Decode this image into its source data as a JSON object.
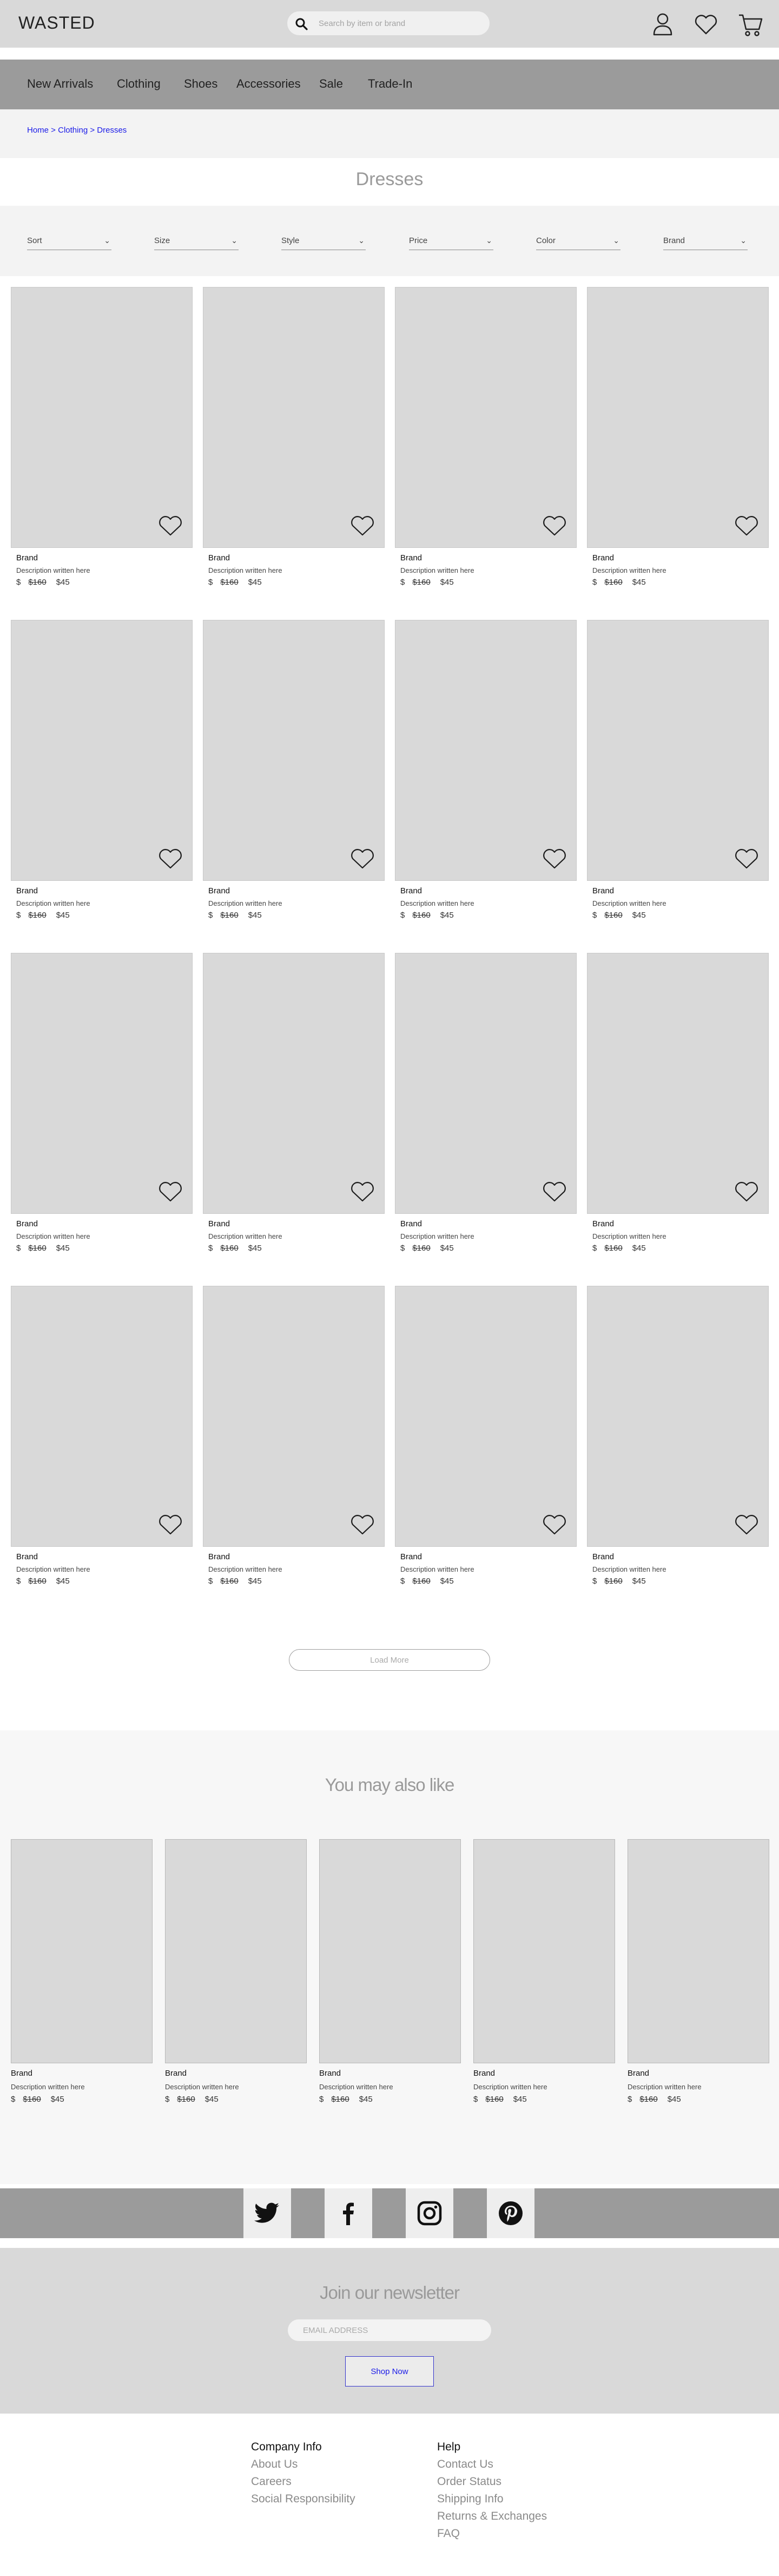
{
  "header": {
    "logo": "WASTED",
    "search_placeholder": "Search by item or brand",
    "icons": [
      "search-icon",
      "user-icon",
      "heart-icon",
      "cart-icon"
    ]
  },
  "nav": {
    "items": [
      "New Arrivals",
      "Clothing",
      "Shoes",
      "Accessories",
      "Sale",
      "Trade-In"
    ]
  },
  "breadcrumb": {
    "home": "Home",
    "sep1": " > ",
    "clothing": "Clothing",
    "sep2": " > ",
    "current": "Dresses"
  },
  "page_title": "Dresses",
  "filters": [
    "Sort",
    "Size",
    "Style",
    "Price",
    "Color",
    "Brand"
  ],
  "filter_chevron": "⌄",
  "product": {
    "brand": "Brand",
    "description": "Description written here",
    "currency": "$",
    "old_price": "$160",
    "new_price": "$45"
  },
  "load_more": "Load More",
  "recommendations": {
    "title": "You may also like"
  },
  "social": {
    "icons": [
      "twitter-icon",
      "facebook-icon",
      "instagram-icon",
      "pinterest-icon"
    ]
  },
  "newsletter": {
    "title": "Join our newsletter",
    "placeholder": "EMAIL ADDRESS",
    "button": "Shop Now"
  },
  "footer": {
    "company": {
      "heading": "Company Info",
      "links": [
        "About Us",
        "Careers",
        "Social Responsibility"
      ]
    },
    "help": {
      "heading": "Help",
      "links": [
        "Contact Us",
        "Order Status",
        "Shipping Info",
        "Returns & Exchanges",
        "FAQ"
      ]
    }
  },
  "colors": {
    "header_bg": "#d9d9d9",
    "nav_bg": "#9b9b9b",
    "placeholder_gray": "#d9d9d9",
    "link_blue": "#1a1ae8"
  }
}
